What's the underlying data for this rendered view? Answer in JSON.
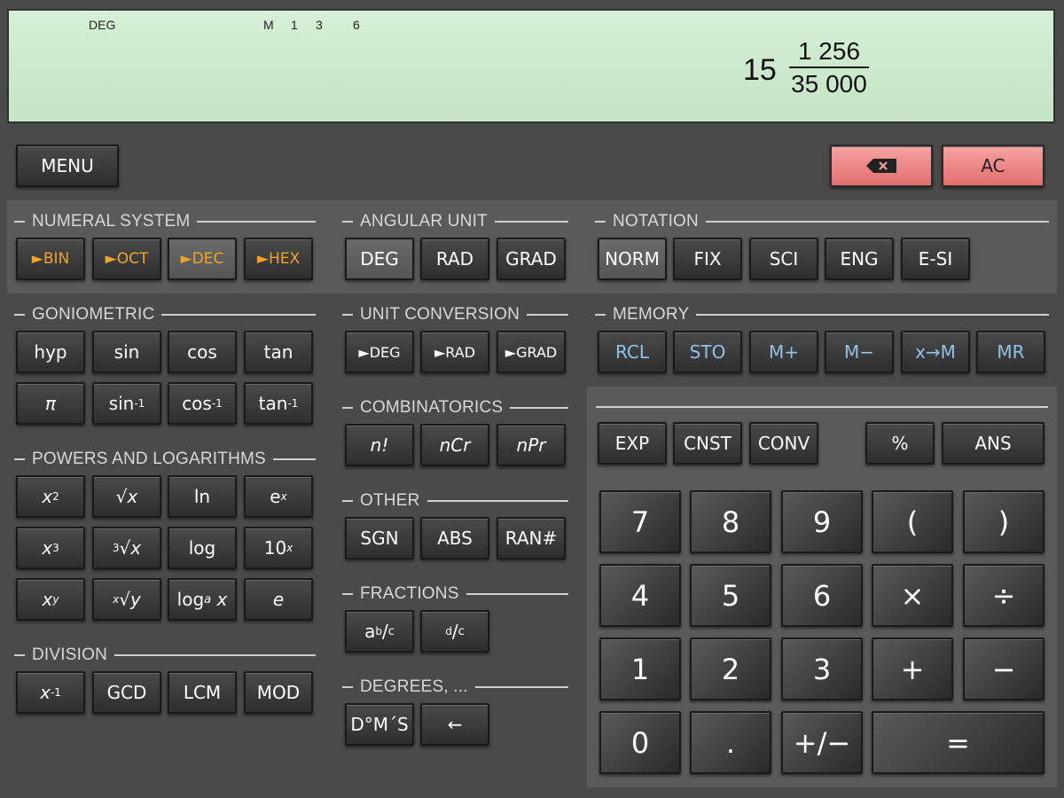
{
  "display": {
    "indicators": {
      "angle": "DEG",
      "memory": "M",
      "m1": "1",
      "m3": "3",
      "m6": "6"
    },
    "result": {
      "whole": "15",
      "numerator": "1 256",
      "denominator": "35 000"
    }
  },
  "top": {
    "menu": "MENU",
    "backspace_icon": "backspace-icon",
    "clear": "AC"
  },
  "numeral_system": {
    "title": "NUMERAL SYSTEM",
    "keys": [
      "►BIN",
      "►OCT",
      "►DEC",
      "►HEX"
    ],
    "selected": "►DEC"
  },
  "angular_unit": {
    "title": "ANGULAR UNIT",
    "keys": [
      "DEG",
      "RAD",
      "GRAD"
    ],
    "selected": "DEG"
  },
  "notation": {
    "title": "NOTATION",
    "keys": [
      "NORM",
      "FIX",
      "SCI",
      "ENG",
      "E-SI"
    ],
    "selected": "NORM"
  },
  "goniometric": {
    "title": "GONIOMETRIC",
    "row1": [
      "hyp",
      "sin",
      "cos",
      "tan"
    ],
    "row2": [
      "π",
      "sin",
      "cos",
      "tan"
    ],
    "inv_sup": "-1"
  },
  "unit_conversion": {
    "title": "UNIT CONVERSION",
    "keys": [
      "►DEG",
      "►RAD",
      "►GRAD"
    ]
  },
  "memory": {
    "title": "MEMORY",
    "keys": [
      "RCL",
      "STO",
      "M+",
      "M−",
      "x→M",
      "MR"
    ]
  },
  "combinatorics": {
    "title": "COMBINATORICS",
    "keys": [
      "n!",
      "nCr",
      "nPr"
    ]
  },
  "powers": {
    "title": "POWERS AND LOGARITHMS",
    "row1": [
      "x2",
      "√x",
      "ln",
      "ex"
    ],
    "row2": [
      "x3",
      "3√x",
      "log",
      "10x"
    ],
    "row3": [
      "xy",
      "x√y",
      "loga x",
      "e"
    ]
  },
  "other": {
    "title": "OTHER",
    "keys": [
      "SGN",
      "ABS",
      "RAN#"
    ]
  },
  "fractions": {
    "title": "FRACTIONS",
    "keys": [
      "ab/c",
      "d/c"
    ]
  },
  "division": {
    "title": "DIVISION",
    "keys": [
      "x-1",
      "GCD",
      "LCM",
      "MOD"
    ]
  },
  "degrees": {
    "title": "DEGREES, ...",
    "keys": [
      "D°M´S",
      "←"
    ]
  },
  "keypad": {
    "functions": [
      "EXP",
      "CNST",
      "CONV",
      "%",
      "ANS"
    ],
    "row1": [
      "7",
      "8",
      "9",
      "(",
      ")"
    ],
    "row2": [
      "4",
      "5",
      "6",
      "×",
      "÷"
    ],
    "row3": [
      "1",
      "2",
      "3",
      "+",
      "−"
    ],
    "row4": [
      "0",
      ".",
      "+/−",
      "="
    ]
  }
}
